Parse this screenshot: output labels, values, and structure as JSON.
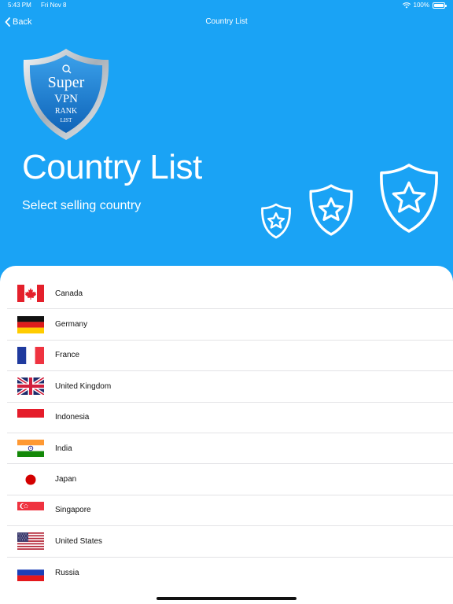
{
  "status_bar": {
    "time": "5:43 PM",
    "date": "Fri Nov 8",
    "battery": "100%"
  },
  "nav": {
    "back_label": "Back",
    "title": "Country List"
  },
  "logo": {
    "line1": "Super",
    "line2": "VPN",
    "line3": "RANK",
    "line4": "LIST"
  },
  "header": {
    "title": "Country List",
    "subtitle": "Select selling country"
  },
  "countries": [
    {
      "name": "Canada",
      "flag": "canada-flag"
    },
    {
      "name": "Germany",
      "flag": "germany-flag"
    },
    {
      "name": "France",
      "flag": "france-flag"
    },
    {
      "name": "United Kingdom",
      "flag": "uk-flag"
    },
    {
      "name": "Indonesia",
      "flag": "indonesia-flag"
    },
    {
      "name": "India",
      "flag": "india-flag"
    },
    {
      "name": "Japan",
      "flag": "japan-flag"
    },
    {
      "name": "Singapore",
      "flag": "singapore-flag"
    },
    {
      "name": "United States",
      "flag": "usa-flag"
    },
    {
      "name": "Russia",
      "flag": "russia-flag"
    }
  ],
  "colors": {
    "background": "#1aa3f5",
    "card": "#ffffff",
    "separator": "#e3e3e6"
  }
}
